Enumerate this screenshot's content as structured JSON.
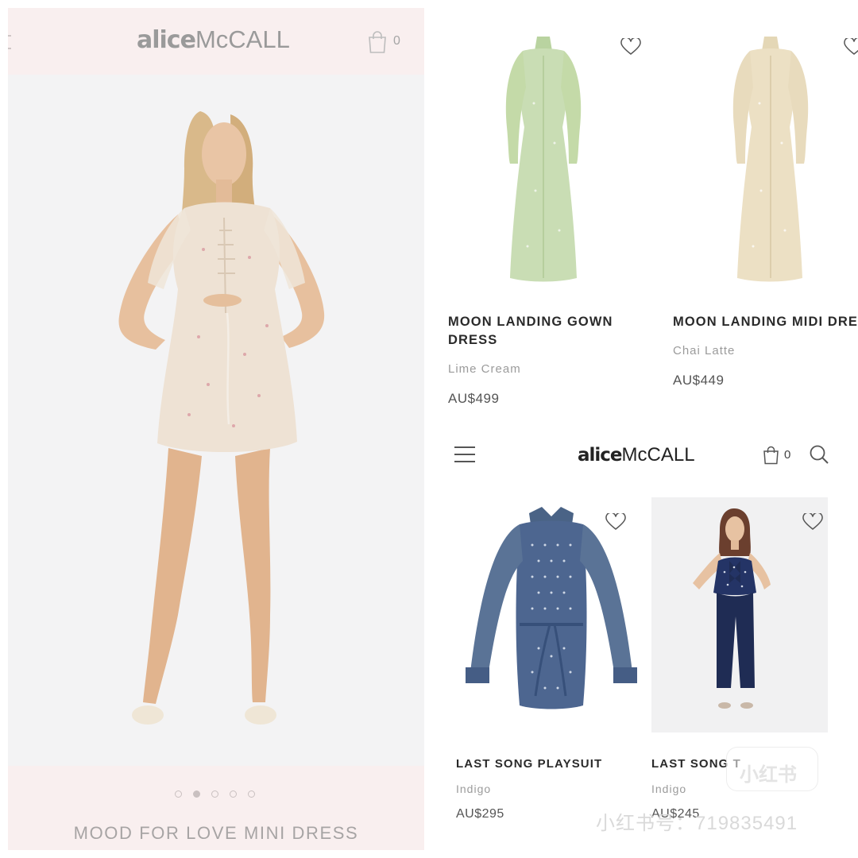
{
  "left_screen": {
    "brand": {
      "word1": "alice",
      "word2": "McCALL"
    },
    "bag_count": "0",
    "carousel": {
      "slides": 5,
      "active_index": 1
    },
    "hero_title": "MOOD FOR LOVE MINI DRESS",
    "colors": {
      "header_bg": "#f9efef",
      "image_bg": "#f3f3f4",
      "dress": "#eee2d4"
    }
  },
  "right_screen": {
    "top_products": [
      {
        "name_lines": [
          "MOON LANDING GOWN",
          "DRESS"
        ],
        "color": "Lime Cream",
        "price": "AU$499",
        "swatch": "#c9ddb4"
      },
      {
        "name_lines": [
          "MOON LANDING MIDI DRE"
        ],
        "color": "Chai Latte",
        "price": "AU$449",
        "swatch": "#ece0c4"
      }
    ],
    "header": {
      "brand": {
        "word1": "alice",
        "word2": "McCALL"
      },
      "bag_count": "0"
    },
    "bottom_products": [
      {
        "name": "LAST SONG PLAYSUIT",
        "color": "Indigo",
        "price": "AU$295",
        "swatch": "#5a7396"
      },
      {
        "name": "LAST SONG T",
        "color": "Indigo",
        "price": "AU$245",
        "swatch": "#1f2c54"
      }
    ]
  },
  "watermark": {
    "badge": "小红书",
    "text": "小红书号：719835491"
  }
}
